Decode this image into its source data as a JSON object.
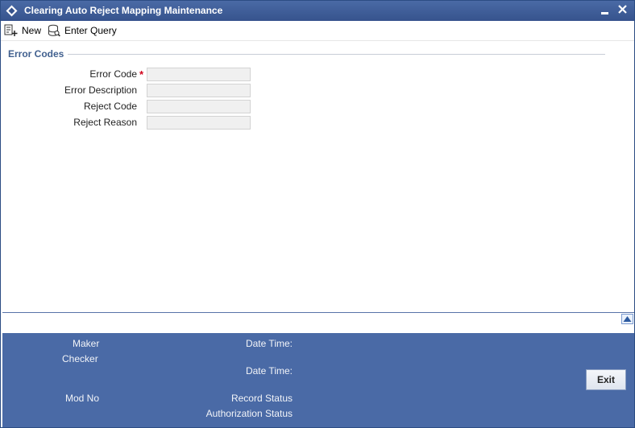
{
  "window": {
    "title": "Clearing Auto Reject Mapping Maintenance"
  },
  "toolbar": {
    "new_label": "New",
    "enter_query_label": "Enter Query"
  },
  "section": {
    "title": "Error Codes"
  },
  "fields": {
    "error_code": {
      "label": "Error Code",
      "value": "",
      "required_marker": "*"
    },
    "error_description": {
      "label": "Error Description",
      "value": ""
    },
    "reject_code": {
      "label": "Reject Code",
      "value": ""
    },
    "reject_reason": {
      "label": "Reject Reason",
      "value": ""
    }
  },
  "footer": {
    "maker_label": "Maker",
    "checker_label": "Checker",
    "date_time_label_1": "Date Time:",
    "date_time_label_2": "Date Time:",
    "mod_no_label": "Mod No",
    "record_status_label": "Record Status",
    "authorization_status_label": "Authorization Status",
    "exit_label": "Exit"
  },
  "colors": {
    "titlebar": "#36538d",
    "footer": "#4a6aa6",
    "section_title": "#41608f",
    "required": "#d0021b"
  }
}
